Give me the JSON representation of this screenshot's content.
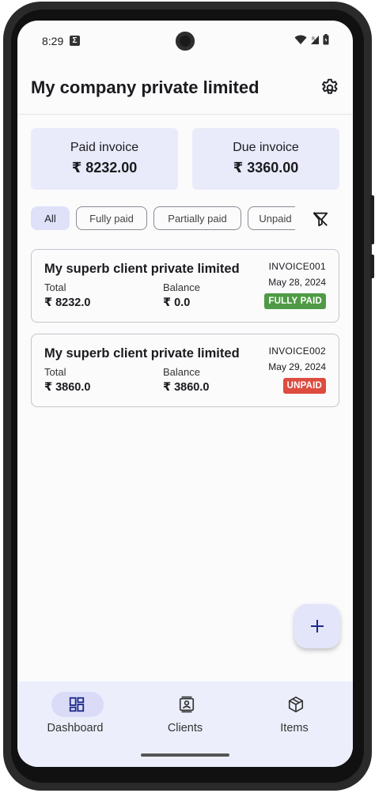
{
  "status_bar": {
    "time": "8:29",
    "notification_badge": "Σ"
  },
  "app_bar": {
    "title": "My company private limited",
    "settings_icon": "gear-icon"
  },
  "summary": {
    "paid": {
      "label": "Paid invoice",
      "value": "₹ 8232.00"
    },
    "due": {
      "label": "Due invoice",
      "value": "₹ 3360.00"
    }
  },
  "filters": {
    "chips": [
      "All",
      "Fully paid",
      "Partially paid",
      "Unpaid"
    ],
    "selected": "All",
    "clear_icon": "filter-off-icon"
  },
  "invoices": [
    {
      "client": "My superb client private limited",
      "total_label": "Total",
      "total": "₹ 8232.0",
      "balance_label": "Balance",
      "balance": "₹ 0.0",
      "number": "INVOICE001",
      "date": "May 28, 2024",
      "status": "FULLY PAID",
      "status_color": "#4f9b45"
    },
    {
      "client": "My superb client private limited",
      "total_label": "Total",
      "total": "₹ 3860.0",
      "balance_label": "Balance",
      "balance": "₹ 3860.0",
      "number": "INVOICE002",
      "date": "May 29, 2024",
      "status": "UNPAID",
      "status_color": "#de4b3f"
    }
  ],
  "fab": {
    "icon": "plus-icon"
  },
  "bottom_nav": {
    "items": [
      {
        "label": "Dashboard",
        "icon": "dashboard-icon",
        "active": true
      },
      {
        "label": "Clients",
        "icon": "contacts-icon",
        "active": false
      },
      {
        "label": "Items",
        "icon": "package-icon",
        "active": false
      }
    ]
  },
  "colors": {
    "accent": "#1f2a8c",
    "card_bg": "#e9ebfa",
    "nav_bg": "#eceffb"
  }
}
